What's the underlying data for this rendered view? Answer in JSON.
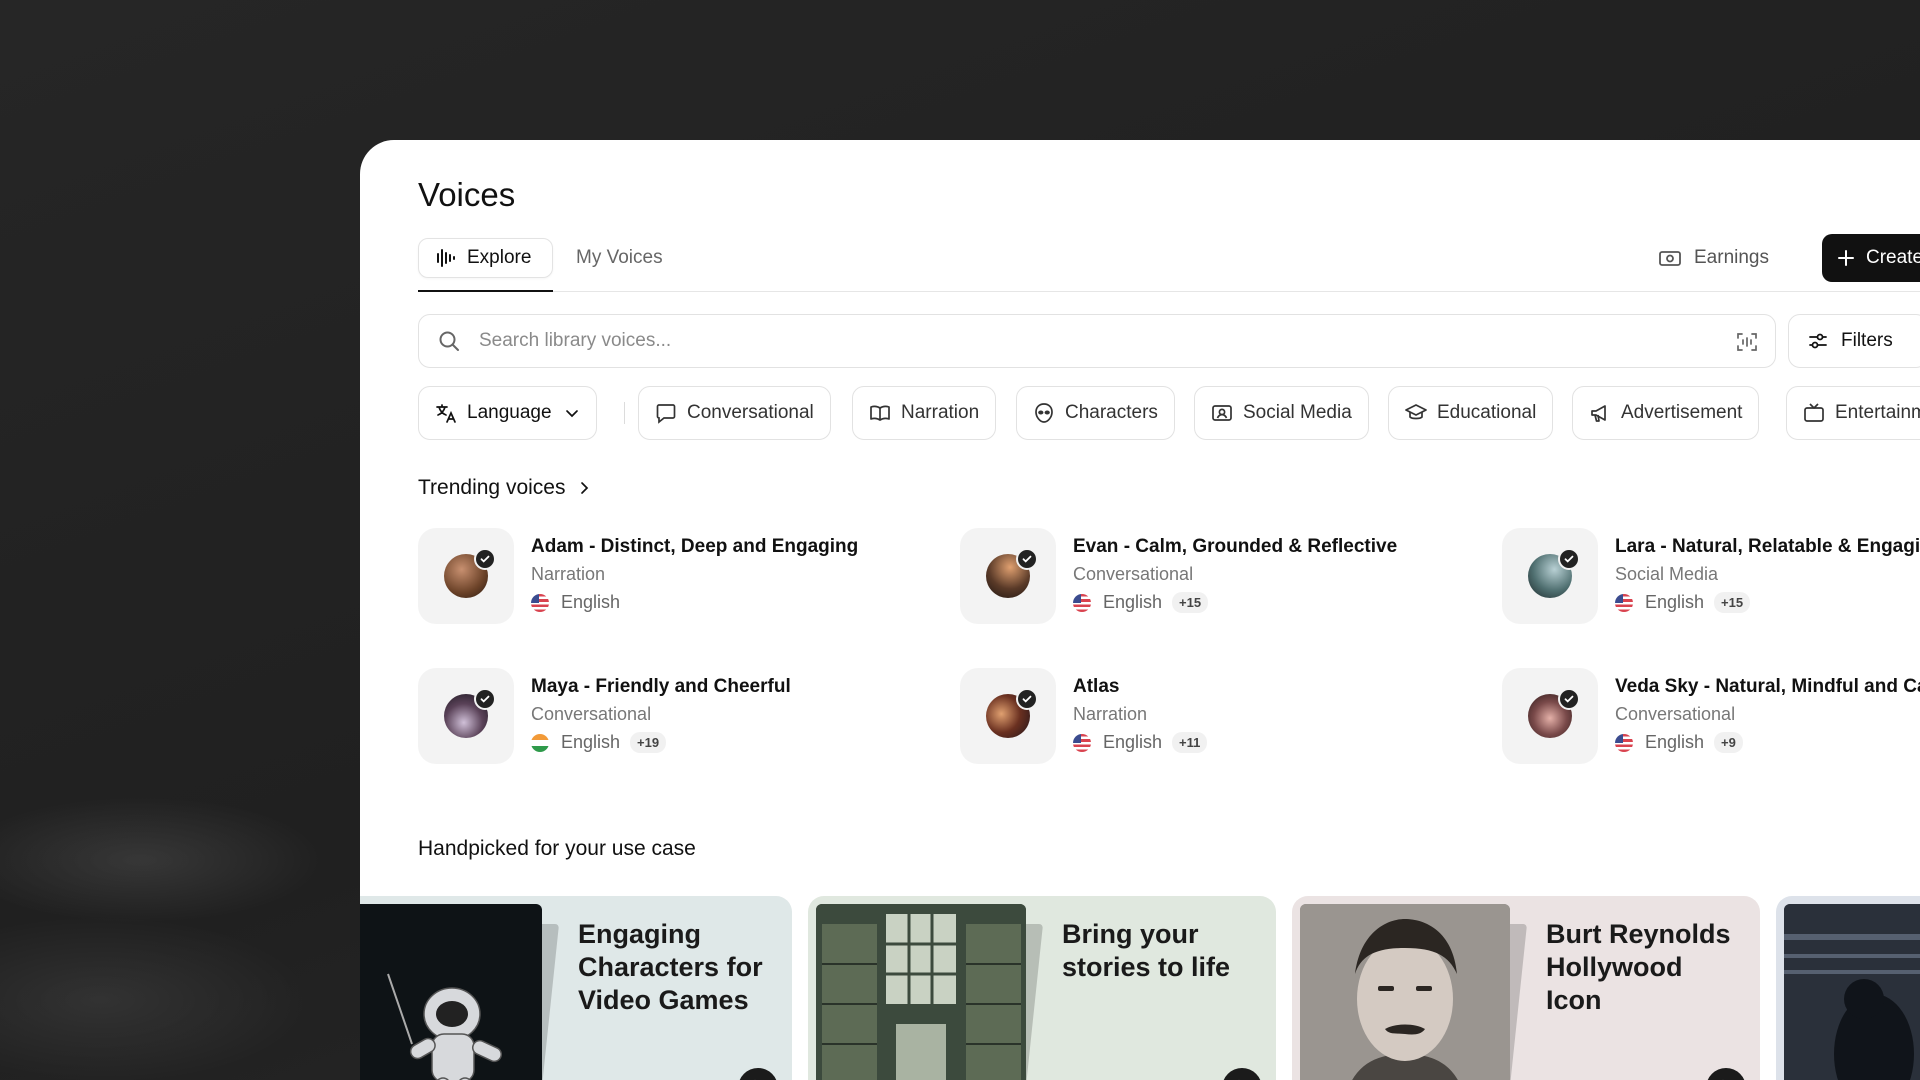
{
  "page": {
    "title": "Voices"
  },
  "tabs": [
    {
      "label": "Explore",
      "active": true,
      "icon": "waveform-icon"
    },
    {
      "label": "My Voices",
      "active": false
    }
  ],
  "header_actions": {
    "earnings_label": "Earnings",
    "create_label": "Create"
  },
  "search": {
    "placeholder": "Search library voices...",
    "value": ""
  },
  "filters_label": "Filters",
  "chips": [
    {
      "label": "Language",
      "icon": "translate-icon",
      "dropdown": true
    },
    {
      "label": "Conversational",
      "icon": "chat-bubble-icon"
    },
    {
      "label": "Narration",
      "icon": "book-icon"
    },
    {
      "label": "Characters",
      "icon": "alien-face-icon"
    },
    {
      "label": "Social Media",
      "icon": "profile-card-icon"
    },
    {
      "label": "Educational",
      "icon": "graduation-cap-icon"
    },
    {
      "label": "Advertisement",
      "icon": "megaphone-icon"
    },
    {
      "label": "Entertainment",
      "icon": "tv-icon"
    }
  ],
  "trending": {
    "title": "Trending voices",
    "voices": [
      {
        "name": "Adam - Distinct, Deep and Engaging",
        "category": "Narration",
        "language": "English",
        "flag": "us",
        "extra": ""
      },
      {
        "name": "Evan - Calm, Grounded & Reflective",
        "category": "Conversational",
        "language": "English",
        "flag": "us",
        "extra": "+15"
      },
      {
        "name": "Lara - Natural, Relatable & Engaging",
        "category": "Social Media",
        "language": "English",
        "flag": "us",
        "extra": "+15"
      },
      {
        "name": "Maya - Friendly and Cheerful",
        "category": "Conversational",
        "language": "English",
        "flag": "in",
        "extra": "+19"
      },
      {
        "name": "Atlas",
        "category": "Narration",
        "language": "English",
        "flag": "us",
        "extra": "+11"
      },
      {
        "name": "Veda Sky - Natural, Mindful and Calm",
        "category": "Conversational",
        "language": "English",
        "flag": "us",
        "extra": "+9"
      }
    ]
  },
  "handpicked": {
    "title": "Handpicked for your use case",
    "cards": [
      {
        "title": "Engaging Characters for Video Games",
        "bg": "#dfe8e8"
      },
      {
        "title": "Bring your stories to life",
        "bg": "#e0e8df"
      },
      {
        "title": "Burt Reynolds Hollywood Icon",
        "bg": "#ebe3e3"
      },
      {
        "title": "",
        "bg": "#dde2ea"
      }
    ]
  },
  "colors": {
    "accent": "#111111",
    "panel": "#ffffff",
    "backdrop": "#232323"
  }
}
